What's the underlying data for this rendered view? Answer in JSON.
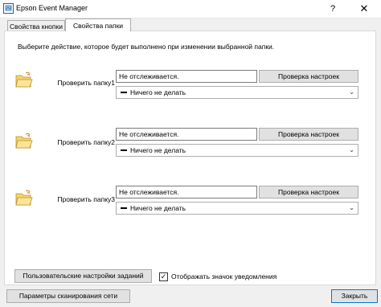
{
  "window": {
    "title": "Epson Event Manager",
    "help_label": "?",
    "close_label": "✕"
  },
  "tabs": [
    {
      "label": "Свойства кнопки"
    },
    {
      "label": "Свойства папки"
    }
  ],
  "instruction": "Выберите действие, которое будет выполнено при изменении выбранной папки.",
  "folders": [
    {
      "label": "Проверить папку1",
      "status": "Не отслеживается.",
      "check_button": "Проверка настроек",
      "action": "Ничего не делать"
    },
    {
      "label": "Проверить папку2",
      "status": "Не отслеживается.",
      "check_button": "Проверка настроек",
      "action": "Ничего не делать"
    },
    {
      "label": "Проверить папку3",
      "status": "Не отслеживается.",
      "check_button": "Проверка настроек",
      "action": "Ничего не делать"
    }
  ],
  "custom_settings_button": "Пользовательские настройки заданий",
  "notification_checkbox": {
    "label": "Отображать значок уведомления",
    "checked": true,
    "mark": "✓"
  },
  "network_scan_button": "Параметры сканирования сети",
  "close_button": "Закрыть",
  "icons": {
    "app": "epson-app-icon",
    "folder": "folder-icon",
    "dropdown": "chevron-down-icon"
  },
  "colors": {
    "accent": "#0078d7"
  }
}
